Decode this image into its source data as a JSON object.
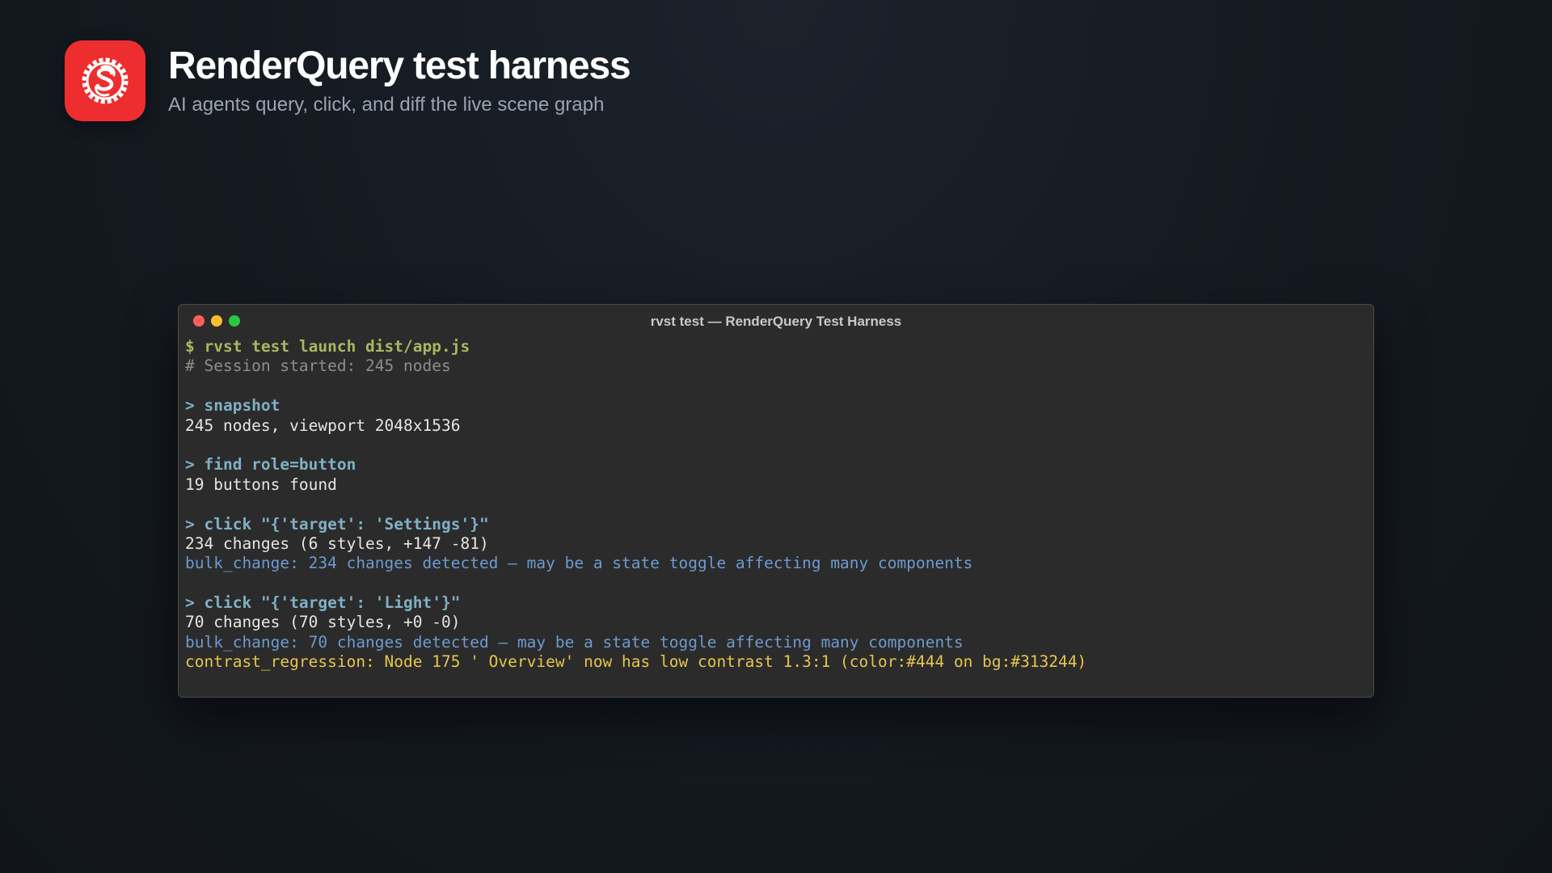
{
  "header": {
    "logo_icon": "svelte-gear-icon",
    "logo_color": "#ee2e2e",
    "title": "RenderQuery test harness",
    "subtitle": "AI agents query, click, and diff the live scene graph"
  },
  "terminal": {
    "window_title": "rvst test — RenderQuery Test Harness",
    "lines": [
      {
        "kind": "shell",
        "text": "$ rvst test launch dist/app.js"
      },
      {
        "kind": "comment",
        "text": "# Session started: 245 nodes"
      },
      {
        "kind": "blank",
        "text": ""
      },
      {
        "kind": "command",
        "text": "> snapshot"
      },
      {
        "kind": "output",
        "text": "245 nodes, viewport 2048x1536"
      },
      {
        "kind": "blank",
        "text": ""
      },
      {
        "kind": "command",
        "text": "> find role=button"
      },
      {
        "kind": "output",
        "text": "19 buttons found"
      },
      {
        "kind": "blank",
        "text": ""
      },
      {
        "kind": "command",
        "text": "> click \"{'target': 'Settings'}\""
      },
      {
        "kind": "output",
        "text": "234 changes (6 styles, +147 -81)"
      },
      {
        "kind": "info",
        "text": "bulk_change: 234 changes detected — may be a state toggle affecting many components"
      },
      {
        "kind": "blank",
        "text": ""
      },
      {
        "kind": "command",
        "text": "> click \"{'target': 'Light'}\""
      },
      {
        "kind": "output",
        "text": "70 changes (70 styles, +0 -0)"
      },
      {
        "kind": "info",
        "text": "bulk_change: 70 changes detected — may be a state toggle affecting many components"
      },
      {
        "kind": "warning",
        "text": "contrast_regression: Node 175 ' Overview' now has low contrast 1.3:1 (color:#444 on bg:#313244)"
      }
    ]
  },
  "colors": {
    "background": "#141920",
    "terminal_bg": "#2b2b2b",
    "shell_prompt": "#a7b85f",
    "comment": "#8d8d8d",
    "command": "#7fb0c4",
    "output": "#e6e6e6",
    "info": "#6d9ad0",
    "warning": "#e7c54a",
    "traffic_close": "#ff5f57",
    "traffic_minimize": "#febc2e",
    "traffic_zoom": "#28c840"
  }
}
